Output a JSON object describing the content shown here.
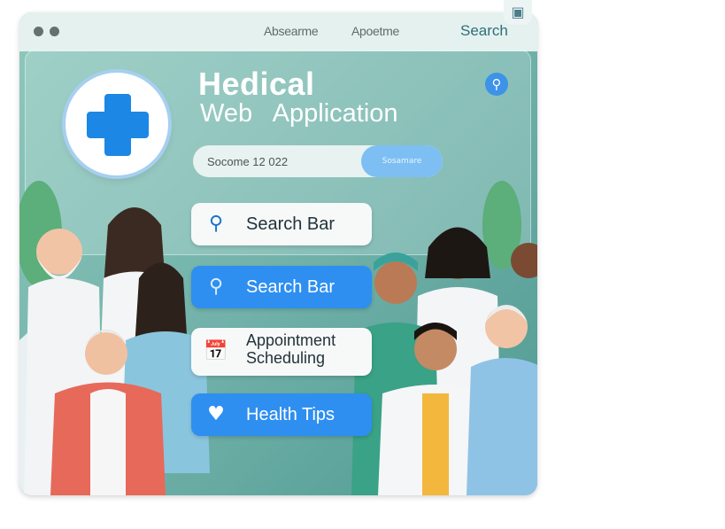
{
  "header": {
    "nav_1": "Absearme",
    "nav_2": "Apoetme",
    "search_label": "Search"
  },
  "hero": {
    "title": "Hedical",
    "subtitle": "Web   Application"
  },
  "search": {
    "input_value": "Socome 12  022",
    "button_label": "Sosamare"
  },
  "menu": {
    "items": [
      {
        "label": "Search Bar",
        "icon": "search-icon"
      },
      {
        "label": "Search Bar",
        "icon": "search-icon"
      },
      {
        "label": "Appointment Scheduling",
        "icon": "calendar-icon"
      },
      {
        "label": "Health Tips",
        "icon": "heart-icon"
      }
    ]
  },
  "colors": {
    "accent_blue": "#2e8ff0",
    "background_teal": "#6fb0a8",
    "cross_blue": "#1c87e4"
  }
}
